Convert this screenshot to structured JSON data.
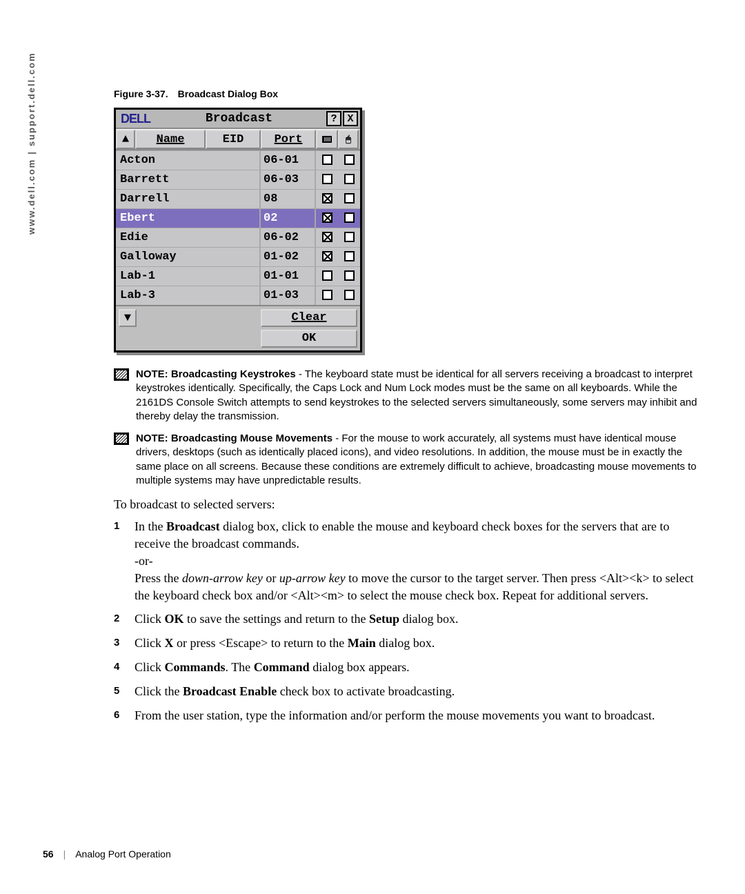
{
  "side": {
    "left": "www.dell.com",
    "right": "support.dell.com"
  },
  "figure": {
    "num": "Figure 3-37.",
    "title": "Broadcast Dialog Box"
  },
  "dialog": {
    "logo": "DELL",
    "title": "Broadcast",
    "help": "?",
    "close": "X",
    "headers": {
      "name": "Name",
      "eid": "EID",
      "port": "Port"
    },
    "rows": [
      {
        "name": "Acton",
        "port": "06-01",
        "kb": false,
        "ms": false,
        "sel": false
      },
      {
        "name": "Barrett",
        "port": "06-03",
        "kb": false,
        "ms": false,
        "sel": false
      },
      {
        "name": "Darrell",
        "port": "08",
        "kb": true,
        "ms": false,
        "sel": false
      },
      {
        "name": "Ebert",
        "port": "02",
        "kb": true,
        "ms": false,
        "sel": true
      },
      {
        "name": "Edie",
        "port": "06-02",
        "kb": true,
        "ms": false,
        "sel": false
      },
      {
        "name": "Galloway",
        "port": "01-02",
        "kb": true,
        "ms": false,
        "sel": false
      },
      {
        "name": "Lab-1",
        "port": "01-01",
        "kb": false,
        "ms": false,
        "sel": false
      },
      {
        "name": "Lab-3",
        "port": "01-03",
        "kb": false,
        "ms": false,
        "sel": false
      }
    ],
    "clear": "Clear",
    "ok": "OK"
  },
  "notes": [
    {
      "label": "NOTE:",
      "lead": "Broadcasting Keystrokes",
      "body": " - The keyboard state must be identical for all servers receiving a broadcast to interpret keystrokes identically. Specifically, the Caps Lock and Num Lock modes must be the same on all keyboards. While the 2161DS Console Switch attempts to send keystrokes to the selected servers simultaneously, some servers may inhibit and thereby delay the transmission."
    },
    {
      "label": "NOTE:",
      "lead": "Broadcasting Mouse Movements",
      "body": " - For the mouse to work accurately, all systems must have identical mouse drivers, desktops (such as identically placed icons), and video resolutions. In addition, the mouse must be in exactly the same place on all screens. Because these conditions are extremely difficult to achieve, broadcasting mouse movements to multiple systems may have unpredictable results."
    }
  ],
  "lead_para": "To broadcast to selected servers:",
  "steps": {
    "s1a": "In the ",
    "s1b": "Broadcast",
    "s1c": " dialog box, click to enable the mouse and keyboard check boxes for the servers that are to receive the broadcast commands.",
    "s1or": "-or-",
    "s1d": "Press the ",
    "s1e": "down-arrow key",
    "s1f": " or ",
    "s1g": "up-arrow key",
    "s1h": " to move the cursor to the target server. Then press <Alt><k> to select the keyboard check box and/or <Alt><m> to select the mouse check box. Repeat for additional servers.",
    "s2a": "Click ",
    "s2b": "OK",
    "s2c": " to save the settings and return to the ",
    "s2d": "Setup",
    "s2e": " dialog box.",
    "s3a": "Click ",
    "s3b": "X",
    "s3c": " or press <Escape> to return to the ",
    "s3d": "Main",
    "s3e": " dialog box.",
    "s4a": "Click ",
    "s4b": "Commands",
    "s4c": ". The ",
    "s4d": "Command",
    "s4e": " dialog box appears.",
    "s5a": "Click the ",
    "s5b": "Broadcast Enable",
    "s5c": " check box to activate broadcasting.",
    "s6": "From the user station, type the information and/or perform the mouse movements you want to broadcast."
  },
  "footer": {
    "page": "56",
    "section": "Analog Port Operation"
  }
}
